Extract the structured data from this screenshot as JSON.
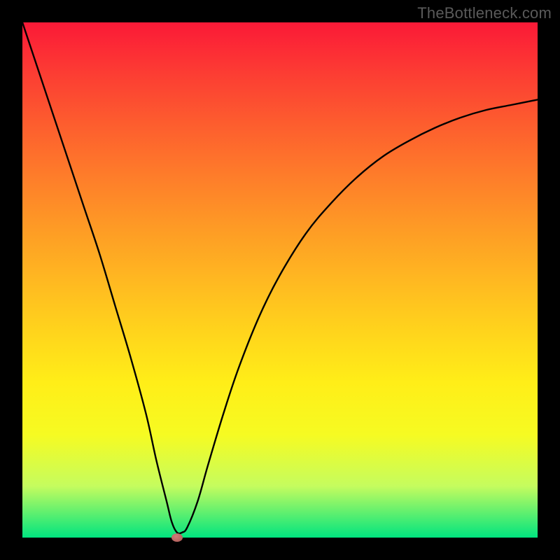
{
  "attribution": "TheBottleneck.com",
  "chart_data": {
    "type": "line",
    "title": "",
    "xlabel": "",
    "ylabel": "",
    "xlim": [
      0,
      100
    ],
    "ylim": [
      0,
      100
    ],
    "x": [
      0,
      3,
      6,
      9,
      12,
      15,
      18,
      21,
      24,
      26,
      28,
      29,
      30,
      31,
      32,
      34,
      36,
      39,
      42,
      46,
      50,
      55,
      60,
      65,
      70,
      75,
      80,
      85,
      90,
      95,
      100
    ],
    "values": [
      100,
      91,
      82,
      73,
      64,
      55,
      45,
      35,
      24,
      15,
      7,
      3,
      1,
      1,
      2,
      7,
      14,
      24,
      33,
      43,
      51,
      59,
      65,
      70,
      74,
      77,
      79.5,
      81.5,
      83,
      84,
      85
    ],
    "min_point": {
      "x": 30,
      "y": 0
    },
    "gradient_stops": [
      {
        "pos": 0,
        "color": "#fb1937"
      },
      {
        "pos": 10,
        "color": "#fc3d33"
      },
      {
        "pos": 20,
        "color": "#fd5e2e"
      },
      {
        "pos": 30,
        "color": "#fe7d2a"
      },
      {
        "pos": 40,
        "color": "#fe9b25"
      },
      {
        "pos": 50,
        "color": "#ffb821"
      },
      {
        "pos": 60,
        "color": "#ffd41c"
      },
      {
        "pos": 70,
        "color": "#ffee18"
      },
      {
        "pos": 80,
        "color": "#f6fb22"
      },
      {
        "pos": 90,
        "color": "#c5fc5e"
      },
      {
        "pos": 100,
        "color": "#00e47f"
      }
    ]
  }
}
